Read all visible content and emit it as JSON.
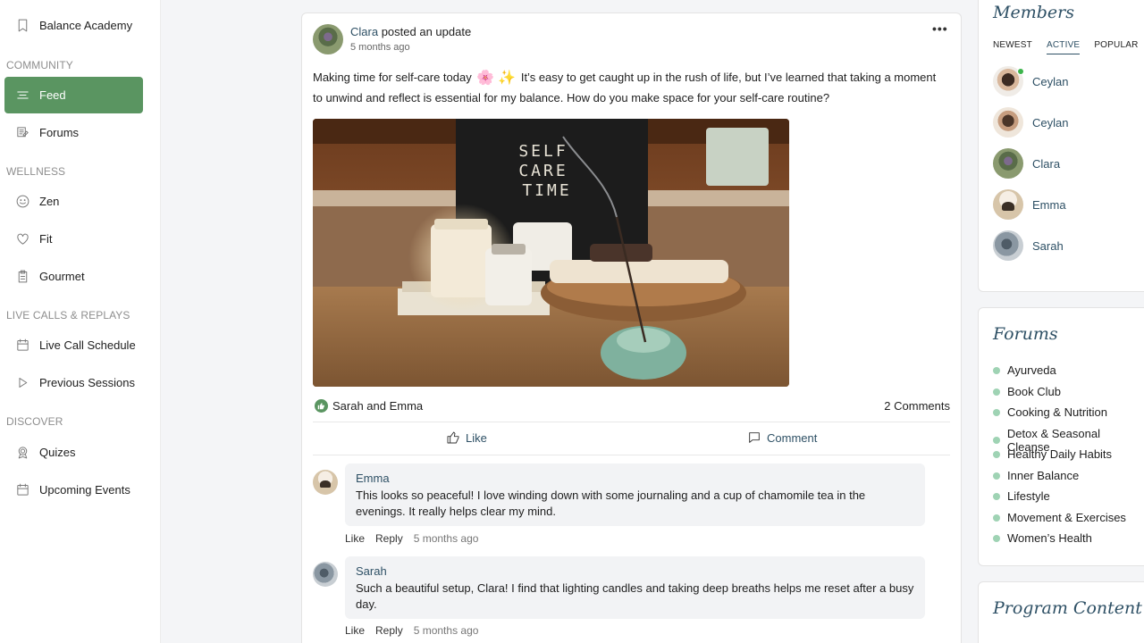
{
  "sidebar": {
    "top_item": "Balance Academy",
    "sections": [
      {
        "heading": "COMMUNITY",
        "items": [
          {
            "label": "Feed",
            "icon": "feed-icon",
            "active": true
          },
          {
            "label": "Forums",
            "icon": "forums-icon"
          }
        ]
      },
      {
        "heading": "WELLNESS",
        "items": [
          {
            "label": "Zen",
            "icon": "smile-icon"
          },
          {
            "label": "Fit",
            "icon": "heart-icon"
          },
          {
            "label": "Gourmet",
            "icon": "clipboard-icon"
          }
        ]
      },
      {
        "heading": "LIVE CALLS & REPLAYS",
        "items": [
          {
            "label": "Live Call Schedule",
            "icon": "calendar-icon"
          },
          {
            "label": "Previous Sessions",
            "icon": "play-icon"
          }
        ]
      },
      {
        "heading": "DISCOVER",
        "items": [
          {
            "label": "Quizes",
            "icon": "award-icon"
          },
          {
            "label": "Upcoming Events",
            "icon": "calendar-icon"
          }
        ]
      }
    ]
  },
  "post": {
    "author": "Clara",
    "action": "posted an update",
    "time": "5 months ago",
    "text_before": "Making time for self-care today",
    "emojis": [
      "🌸",
      "✨"
    ],
    "text_after": "It’s easy to get caught up in the rush of life, but I’ve learned that taking a moment to unwind and reflect is essential for my balance. How do you make space for your self-care routine?",
    "image_text": [
      "SELF",
      "CARE",
      "TIME"
    ],
    "reactions": "Sarah and Emma",
    "comments_count": "2 Comments",
    "like_label": "Like",
    "comment_label": "Comment"
  },
  "comments": [
    {
      "name": "Emma",
      "text": "This looks so peaceful! I love winding down with some journaling and a cup of chamomile tea in the evenings. It really helps clear my mind.",
      "like": "Like",
      "reply": "Reply",
      "time": "5 months ago"
    },
    {
      "name": "Sarah",
      "text": "Such a beautiful setup, Clara! I find that lighting candles and taking deep breaths helps me reset after a busy day.",
      "like": "Like",
      "reply": "Reply",
      "time": "5 months ago"
    }
  ],
  "members": {
    "title": "Members",
    "tabs": [
      "NEWEST",
      "ACTIVE",
      "POPULAR"
    ],
    "active_tab": "ACTIVE",
    "list": [
      {
        "name": "Ceylan",
        "online": true
      },
      {
        "name": "Ceylan",
        "online": false
      },
      {
        "name": "Clara",
        "online": false
      },
      {
        "name": "Emma",
        "online": false
      },
      {
        "name": "Sarah",
        "online": false
      }
    ]
  },
  "forums": {
    "title": "Forums",
    "items": [
      "Ayurveda",
      "Book Club",
      "Cooking & Nutrition",
      "Detox & Seasonal Cleanse",
      "Healthy Daily Habits",
      "Inner Balance",
      "Lifestyle",
      "Movement & Exercises",
      "Women’s Health"
    ]
  },
  "program": {
    "title": "Program Content"
  },
  "colors": {
    "accent": "#5a9561",
    "link": "#2e5065",
    "forum_dot": "#9fd3b4"
  }
}
